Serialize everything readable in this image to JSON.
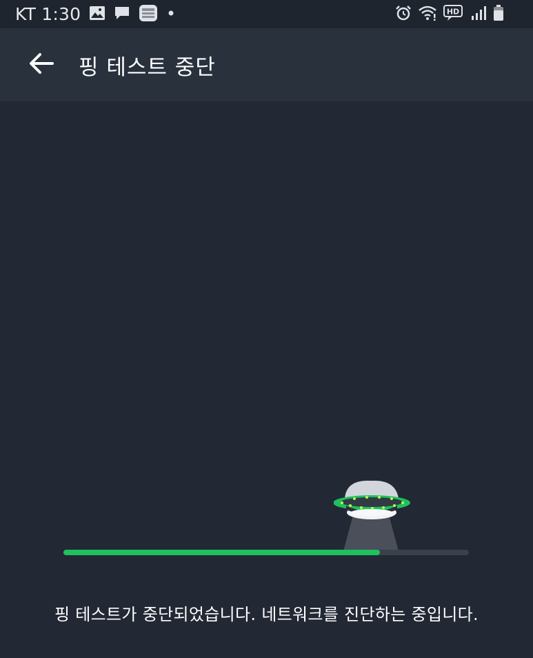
{
  "status_bar": {
    "carrier_time": "KT 1:30",
    "left_icons": [
      "image-icon",
      "message-icon",
      "app-notification-icon",
      "dot-icon"
    ],
    "right_icons": [
      "alarm-icon",
      "wifi-icon",
      "hd-icon",
      "signal-icon",
      "battery-icon"
    ],
    "hd_label": "HD"
  },
  "header": {
    "back_icon": "arrow-left-icon",
    "title": "핑 테스트 중단"
  },
  "main": {
    "progress": 0.78,
    "message": "핑 테스트가 중단되었습니다. 네트워크를 진단하는 중입니다."
  },
  "colors": {
    "background": "#222834",
    "app_bar": "#29313d",
    "accent_green": "#1fc05e",
    "track": "#3b414b"
  }
}
